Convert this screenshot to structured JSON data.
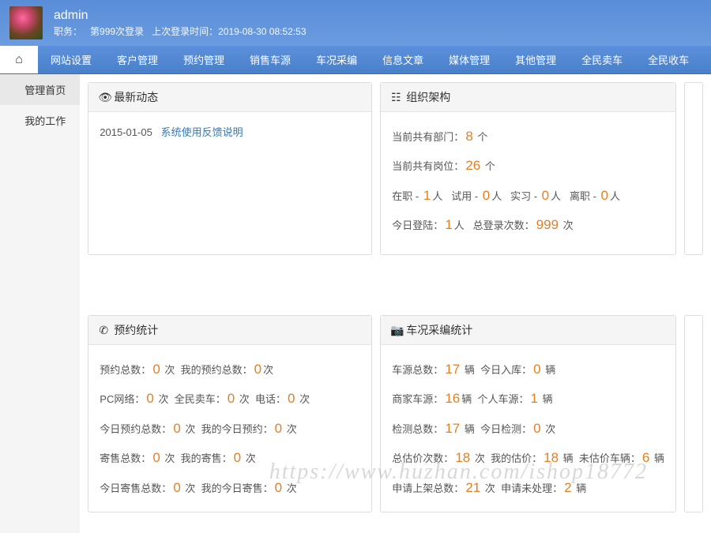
{
  "header": {
    "username": "admin",
    "role_label": "职务：",
    "login_count_label": "第999次登录",
    "last_login_label": "上次登录时间：",
    "last_login_time": "2019-08-30 08:52:53"
  },
  "nav": {
    "items": [
      "网站设置",
      "客户管理",
      "预约管理",
      "销售车源",
      "车况采编",
      "信息文章",
      "媒体管理",
      "其他管理",
      "全民卖车",
      "全民收车"
    ]
  },
  "sidebar": {
    "items": [
      "管理首页",
      "我的工作"
    ]
  },
  "panels": {
    "news": {
      "title": "最新动态",
      "date": "2015-01-05",
      "link_text": "系统使用反馈说明"
    },
    "org": {
      "title": "组织架构",
      "dept_label": "当前共有部门：",
      "dept_count": "8",
      "dept_unit": " 个",
      "pos_label": "当前共有岗位：",
      "pos_count": "26",
      "pos_unit": " 个",
      "onjob_label": "在职 - ",
      "onjob_count": "1",
      "onjob_unit": "人",
      "trial_label": "试用 - ",
      "trial_count": "0",
      "trial_unit": "人",
      "intern_label": "实习 - ",
      "intern_count": "0",
      "intern_unit": "人",
      "leave_label": "离职 - ",
      "leave_count": "0",
      "leave_unit": "人",
      "today_login_label": "今日登陆：",
      "today_login_count": "1",
      "today_login_unit": "人",
      "total_login_label": "总登录次数：",
      "total_login_count": "999",
      "total_login_unit": " 次"
    },
    "booking": {
      "title": "预约统计",
      "total_label": "预约总数：",
      "total_count": "0",
      "total_unit": " 次",
      "my_total_label": "我的预约总数：",
      "my_total_count": "0",
      "my_total_unit": "次",
      "pc_label": "PC网络：",
      "pc_count": "0",
      "pc_unit": " 次",
      "sell_label": "全民卖车：",
      "sell_count": "0",
      "sell_unit": " 次",
      "phone_label": "电话：",
      "phone_count": "0",
      "phone_unit": " 次",
      "today_label": "今日预约总数：",
      "today_count": "0",
      "today_unit": " 次",
      "my_today_label": "我的今日预约：",
      "my_today_count": "0",
      "my_today_unit": " 次",
      "consign_label": "寄售总数：",
      "consign_count": "0",
      "consign_unit": " 次",
      "my_consign_label": "我的寄售：",
      "my_consign_count": "0",
      "my_consign_unit": " 次",
      "today_consign_label": "今日寄售总数：",
      "today_consign_count": "0",
      "today_consign_unit": " 次",
      "my_today_consign_label": "我的今日寄售：",
      "my_today_consign_count": "0",
      "my_today_consign_unit": " 次"
    },
    "vehicle": {
      "title": "车况采编统计",
      "src_label": "车源总数：",
      "src_count": "17",
      "src_unit": " 辆",
      "today_in_label": "今日入库：",
      "today_in_count": "0",
      "today_in_unit": " 辆",
      "dealer_label": "商家车源：",
      "dealer_count": "16",
      "dealer_unit": "辆",
      "personal_label": "个人车源：",
      "personal_count": "1",
      "personal_unit": " 辆",
      "check_label": "检测总数：",
      "check_count": "17",
      "check_unit": " 辆",
      "today_check_label": "今日检测：",
      "today_check_count": "0",
      "today_check_unit": " 次",
      "est_label": "总估价次数：",
      "est_count": "18",
      "est_unit": " 次",
      "my_est_label": "我的估价：",
      "my_est_count": "18",
      "my_est_unit": " 辆",
      "unest_label": "未估价车辆：",
      "unest_count": "6",
      "unest_unit": " 辆",
      "apply_label": "申请上架总数：",
      "apply_count": "21",
      "apply_unit": " 次",
      "pending_label": "申请未处理：",
      "pending_count": "2",
      "pending_unit": " 辆"
    }
  },
  "watermark": "https://www.huzhan.com/ishop18772"
}
